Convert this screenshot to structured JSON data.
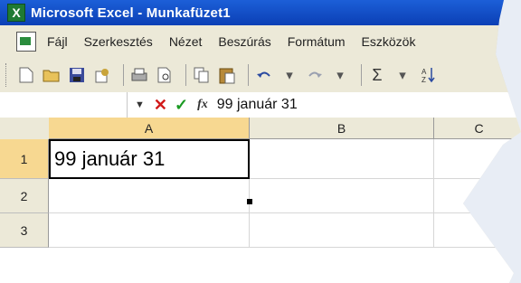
{
  "window": {
    "title": "Microsoft Excel - Munkafüzet1"
  },
  "menu": {
    "items": [
      "Fájl",
      "Szerkesztés",
      "Nézet",
      "Beszúrás",
      "Formátum",
      "Eszközök"
    ]
  },
  "toolbar": {
    "icons": [
      "new-icon",
      "open-icon",
      "save-icon",
      "permission-icon",
      "print-icon",
      "print-preview-icon",
      "copy-icon",
      "paste-icon",
      "undo-icon",
      "redo-icon",
      "autosum-icon",
      "sort-ascending-icon"
    ],
    "dropdown_glyph": "▾",
    "sum_glyph": "Σ"
  },
  "formula_bar": {
    "name_box": "",
    "dropdown": "▼",
    "cancel": "✕",
    "enter": "✓",
    "fx": "fx",
    "value": "99 január 31"
  },
  "sheet": {
    "columns": [
      "A",
      "B",
      "C"
    ],
    "rows": [
      "1",
      "2",
      "3"
    ],
    "cells": {
      "A1": "99 január 31"
    },
    "active_cell": "A1"
  },
  "colors": {
    "titlebar": "#0b3fb5",
    "header_active": "#f7d891",
    "cancel": "#d11919",
    "enter": "#1a9a22"
  }
}
